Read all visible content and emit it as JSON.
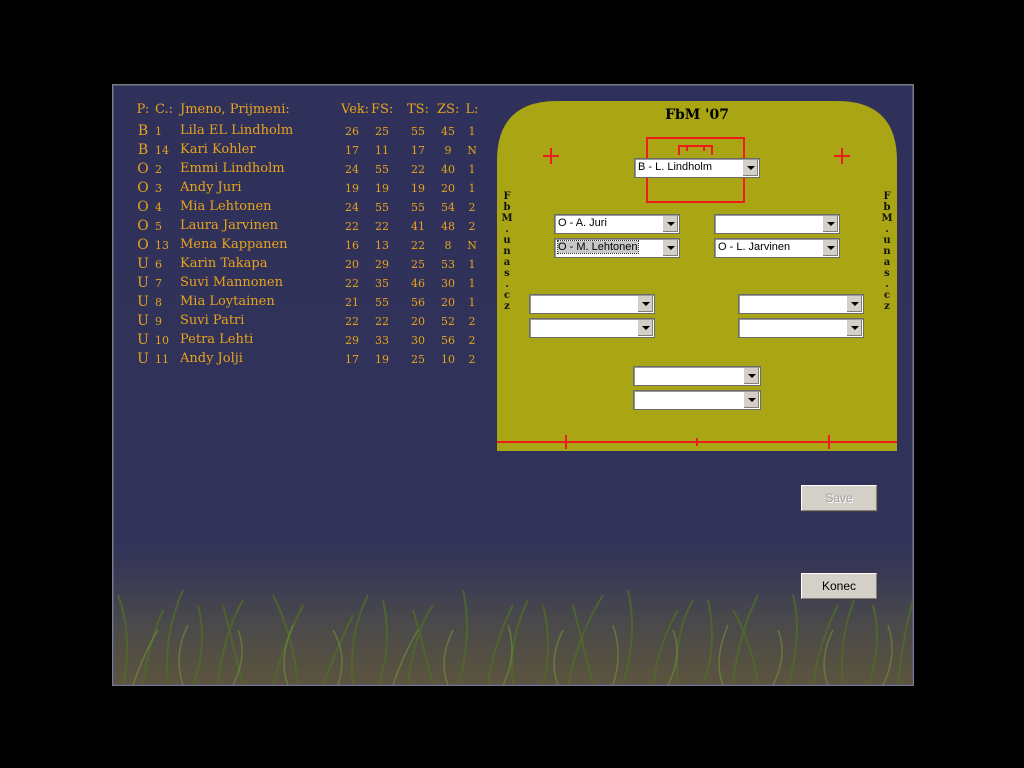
{
  "roster": {
    "headers": {
      "pos": "P:",
      "num": "C.:",
      "name": "Jmeno, Prijmeni:",
      "vek": "Vek:",
      "fs": "FS:",
      "ts": "TS:",
      "zs": "ZS:",
      "l": "L:"
    },
    "players": [
      {
        "pos": "B",
        "num": "1",
        "name": "Lila EL Lindholm",
        "vek": "26",
        "fs": "25",
        "ts": "55",
        "zs": "45",
        "l": "1"
      },
      {
        "pos": "B",
        "num": "14",
        "name": "Kari Kohler",
        "vek": "17",
        "fs": "11",
        "ts": "17",
        "zs": "9",
        "l": "N"
      },
      {
        "pos": "O",
        "num": "2",
        "name": "Emmi Lindholm",
        "vek": "24",
        "fs": "55",
        "ts": "22",
        "zs": "40",
        "l": "1"
      },
      {
        "pos": "O",
        "num": "3",
        "name": "Andy Juri",
        "vek": "19",
        "fs": "19",
        "ts": "19",
        "zs": "20",
        "l": "1"
      },
      {
        "pos": "O",
        "num": "4",
        "name": "Mia Lehtonen",
        "vek": "24",
        "fs": "55",
        "ts": "55",
        "zs": "54",
        "l": "2"
      },
      {
        "pos": "O",
        "num": "5",
        "name": "Laura Jarvinen",
        "vek": "22",
        "fs": "22",
        "ts": "41",
        "zs": "48",
        "l": "2"
      },
      {
        "pos": "O",
        "num": "13",
        "name": "Mena Kappanen",
        "vek": "16",
        "fs": "13",
        "ts": "22",
        "zs": "8",
        "l": "N"
      },
      {
        "pos": "U",
        "num": "6",
        "name": "Karin Takapa",
        "vek": "20",
        "fs": "29",
        "ts": "25",
        "zs": "53",
        "l": "1"
      },
      {
        "pos": "U",
        "num": "7",
        "name": "Suvi Mannonen",
        "vek": "22",
        "fs": "35",
        "ts": "46",
        "zs": "30",
        "l": "1"
      },
      {
        "pos": "U",
        "num": "8",
        "name": "Mia Loytainen",
        "vek": "21",
        "fs": "55",
        "ts": "56",
        "zs": "20",
        "l": "1"
      },
      {
        "pos": "U",
        "num": "9",
        "name": "Suvi Patri",
        "vek": "22",
        "fs": "22",
        "ts": "20",
        "zs": "52",
        "l": "2"
      },
      {
        "pos": "U",
        "num": "10",
        "name": "Petra Lehti",
        "vek": "29",
        "fs": "33",
        "ts": "30",
        "zs": "56",
        "l": "2"
      },
      {
        "pos": "U",
        "num": "11",
        "name": "Andy Jolji",
        "vek": "17",
        "fs": "19",
        "ts": "25",
        "zs": "10",
        "l": "2"
      }
    ]
  },
  "field": {
    "title": "FbM '07",
    "side_text": "FbM.unas.cz",
    "goalkeeper": "B - L. Lindholm",
    "def_left_1": "O - A. Juri",
    "def_right_1": "",
    "def_left_2": "O - M. Lehtonen",
    "def_right_2": "O - L. Jarvinen",
    "fwd_left_1": "",
    "fwd_right_1": "",
    "fwd_left_2": "",
    "fwd_right_2": "",
    "center_1": "",
    "center_2": ""
  },
  "buttons": {
    "save": "Save",
    "end": "Konec"
  },
  "colors": {
    "text": "#e8a31c",
    "field": "#a9a514",
    "lines": "#ee1c1c",
    "panel": "#30315a"
  }
}
